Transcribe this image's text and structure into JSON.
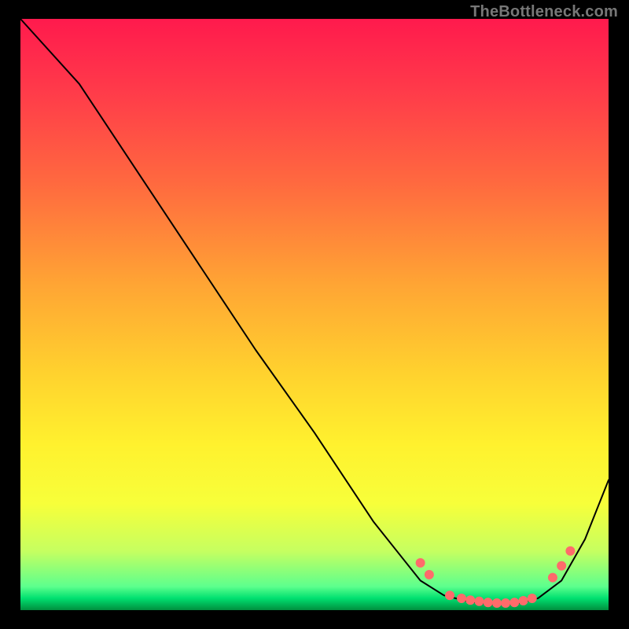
{
  "watermark": "TheBottleneck.com",
  "colors": {
    "background": "#000000",
    "curve": "#000000",
    "dots": "#ff6b6b"
  },
  "chart_data": {
    "type": "line",
    "title": "",
    "xlabel": "",
    "ylabel": "",
    "xlim": [
      0,
      100
    ],
    "ylim": [
      0,
      100
    ],
    "grid": false,
    "series": [
      {
        "name": "bottleneck-curve",
        "x": [
          0,
          10,
          20,
          30,
          40,
          50,
          60,
          68,
          72,
          76,
          80,
          84,
          88,
          92,
          96,
          100
        ],
        "y": [
          100,
          89,
          74,
          59,
          44,
          30,
          15,
          5,
          2.5,
          1.5,
          1,
          1,
          2,
          5,
          12,
          22
        ]
      }
    ],
    "markers": [
      {
        "name": "left-shoulder-top",
        "x": 68.0,
        "y": 8.0
      },
      {
        "name": "left-shoulder-bot",
        "x": 69.5,
        "y": 6.0
      },
      {
        "name": "valley-1",
        "x": 73.0,
        "y": 2.5
      },
      {
        "name": "valley-2",
        "x": 75.0,
        "y": 2.0
      },
      {
        "name": "valley-3",
        "x": 76.5,
        "y": 1.7
      },
      {
        "name": "valley-4",
        "x": 78.0,
        "y": 1.5
      },
      {
        "name": "valley-5",
        "x": 79.5,
        "y": 1.3
      },
      {
        "name": "valley-6",
        "x": 81.0,
        "y": 1.2
      },
      {
        "name": "valley-7",
        "x": 82.5,
        "y": 1.2
      },
      {
        "name": "valley-8",
        "x": 84.0,
        "y": 1.3
      },
      {
        "name": "valley-9",
        "x": 85.5,
        "y": 1.6
      },
      {
        "name": "valley-10",
        "x": 87.0,
        "y": 2.0
      },
      {
        "name": "right-rise-1",
        "x": 90.5,
        "y": 5.5
      },
      {
        "name": "right-rise-2",
        "x": 92.0,
        "y": 7.5
      },
      {
        "name": "right-rise-3",
        "x": 93.5,
        "y": 10.0
      }
    ]
  }
}
